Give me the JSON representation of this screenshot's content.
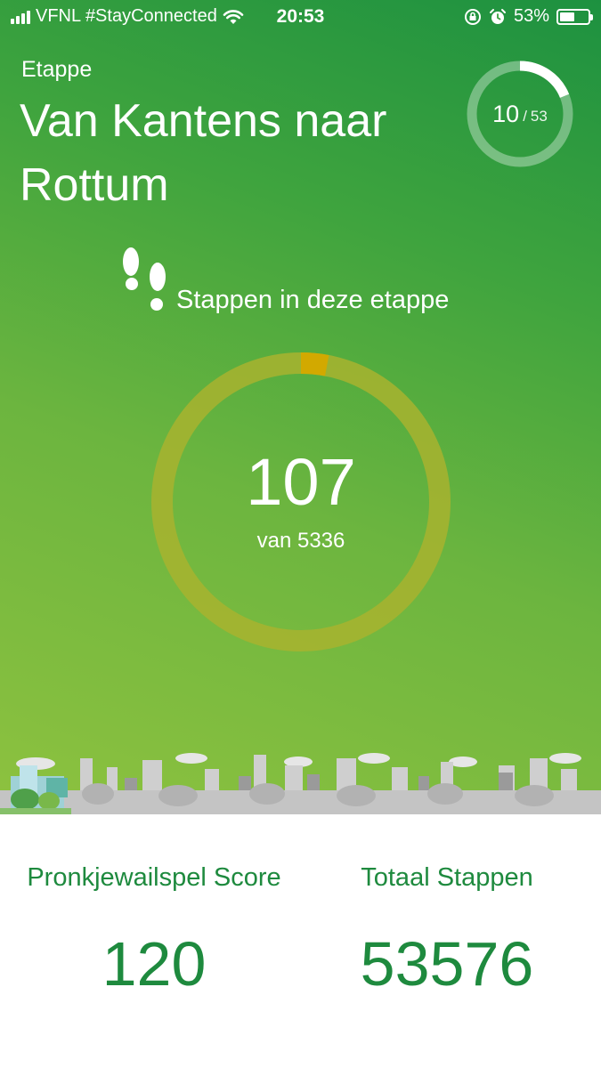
{
  "status_bar": {
    "carrier": "VFNL #StayConnected",
    "time": "20:53",
    "battery_percent": "53%",
    "battery_level": 0.53
  },
  "stage": {
    "label": "Etappe",
    "title": "Van Kantens naar Rottum",
    "current": "10",
    "total": "53"
  },
  "steps": {
    "label": "Stappen in deze etappe",
    "value": "107",
    "of_text": "van 5336",
    "current": 107,
    "goal": 5336
  },
  "stats": {
    "score_label": "Pronkjewailspel Score",
    "score_value": "120",
    "total_label": "Totaal Stappen",
    "total_value": "53576"
  },
  "colors": {
    "accent": "#1e8a3e",
    "ring_progress": "#d2a900",
    "ring_track": "#a8b32f"
  },
  "icons": [
    "signal-icon",
    "wifi-icon",
    "rotation-lock-icon",
    "alarm-icon",
    "battery-icon",
    "footsteps-icon"
  ]
}
